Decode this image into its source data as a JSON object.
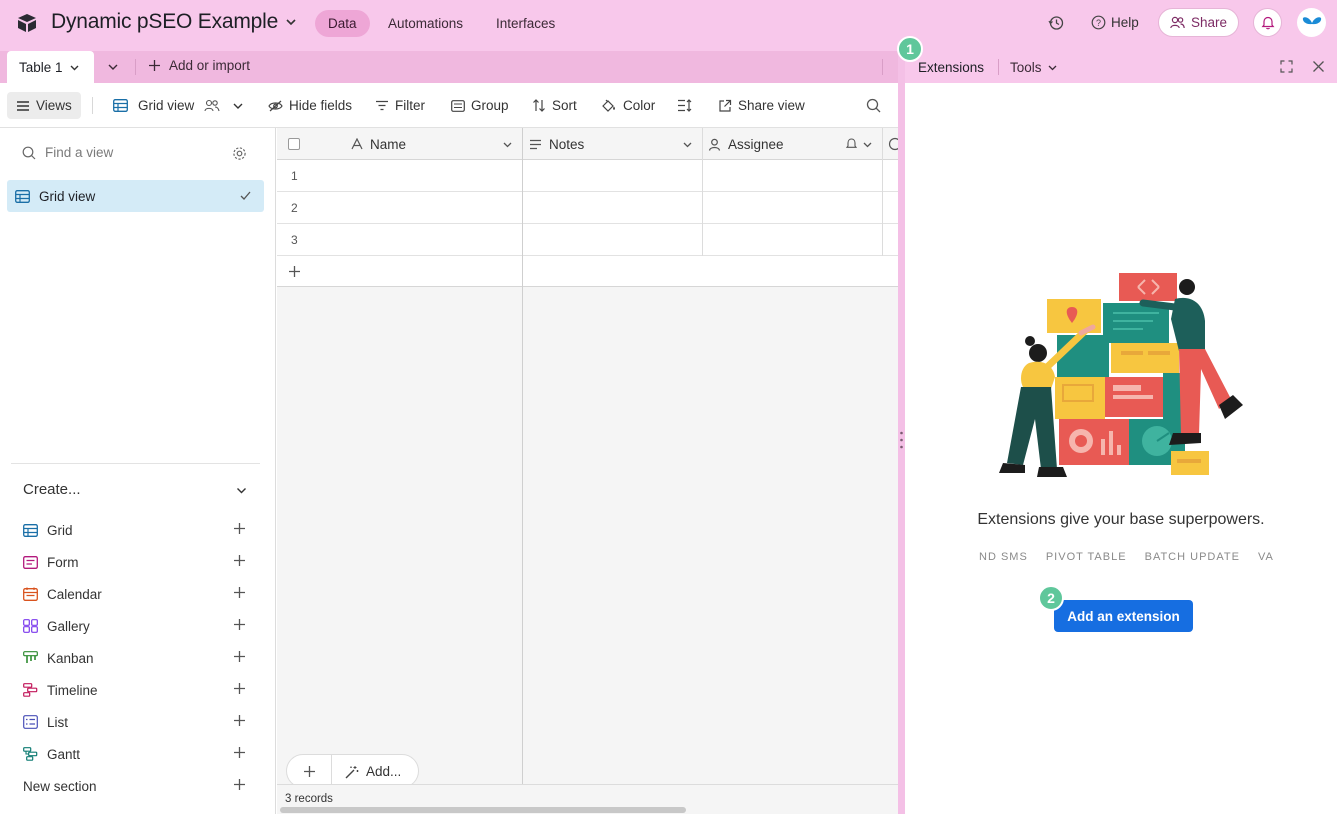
{
  "topbar": {
    "base_title": "Dynamic pSEO Example",
    "tabs": [
      "Data",
      "Automations",
      "Interfaces"
    ],
    "help_label": "Help",
    "share_label": "Share"
  },
  "tablebar": {
    "table_tab": "Table 1",
    "add_import": "Add or import"
  },
  "toolbar": {
    "views": "Views",
    "grid_view": "Grid view",
    "hide_fields": "Hide fields",
    "filter": "Filter",
    "group": "Group",
    "sort": "Sort",
    "color": "Color",
    "share_view": "Share view"
  },
  "sidebar": {
    "find_placeholder": "Find a view",
    "active_view": "Grid view",
    "create_heading": "Create...",
    "create_items": [
      {
        "label": "Grid",
        "icon": "grid-icon",
        "color": "#1a6fa7"
      },
      {
        "label": "Form",
        "icon": "form-icon",
        "color": "#b3197d"
      },
      {
        "label": "Calendar",
        "icon": "calendar-icon",
        "color": "#d9531e"
      },
      {
        "label": "Gallery",
        "icon": "gallery-icon",
        "color": "#7c3aed"
      },
      {
        "label": "Kanban",
        "icon": "kanban-icon",
        "color": "#2e8b30"
      },
      {
        "label": "Timeline",
        "icon": "timeline-icon",
        "color": "#c2185b"
      },
      {
        "label": "List",
        "icon": "list-icon",
        "color": "#4a50b8"
      },
      {
        "label": "Gantt",
        "icon": "gantt-icon",
        "color": "#0f7c73"
      }
    ],
    "new_section": "New section"
  },
  "grid": {
    "columns": [
      "Name",
      "Notes",
      "Assignee"
    ],
    "row_numbers": [
      "1",
      "2",
      "3"
    ],
    "add_label": "Add...",
    "records": "3 records"
  },
  "extensions": {
    "tab_extensions": "Extensions",
    "tab_tools": "Tools",
    "tagline": "Extensions give your base superpowers.",
    "ticker": [
      "ND SMS",
      "PIVOT TABLE",
      "BATCH UPDATE",
      "VA"
    ],
    "add_button": "Add an extension",
    "markers": [
      "1",
      "2"
    ]
  }
}
